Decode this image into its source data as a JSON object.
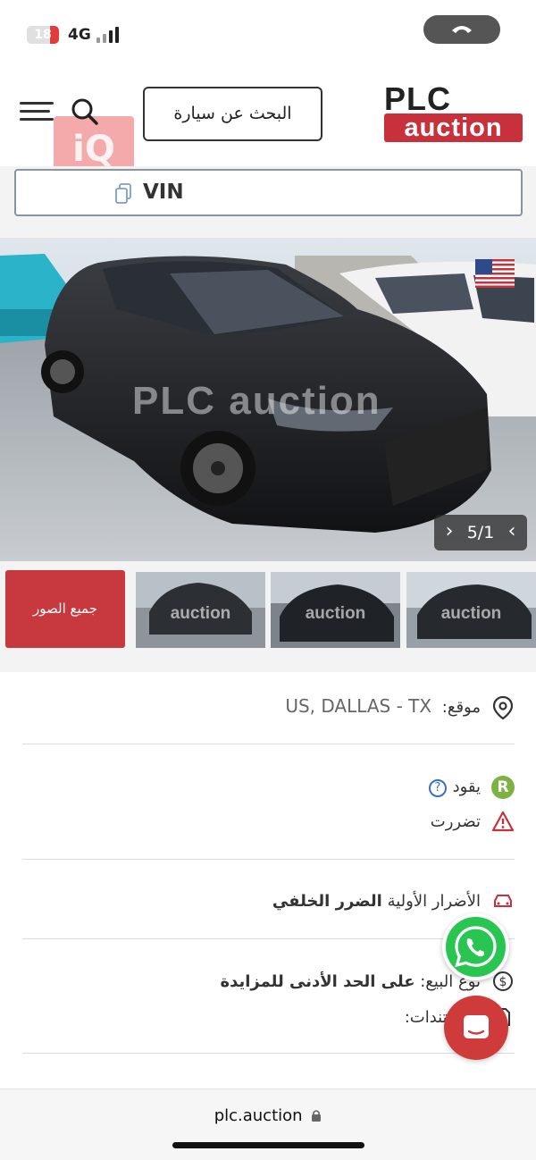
{
  "status_bar": {
    "battery": "18",
    "network": "4G"
  },
  "header": {
    "search_car_label": "البحث عن سيارة",
    "logo_top": "PLC",
    "logo_bottom": "auction",
    "overlay_badge": "iQ"
  },
  "vin": {
    "label": "VIN"
  },
  "gallery": {
    "counter": "5/1",
    "watermark": "PLC auction",
    "prev_icon": "chevron-left-icon",
    "next_icon": "chevron-right-icon",
    "flag": "us-flag-icon",
    "all_photos_label": "جميع الصور",
    "thumb_watermark": "auction"
  },
  "details": {
    "location_label": "موقع:",
    "location_value": "US, DALLAS - TX",
    "runs_label": "يقود",
    "damaged_label": "تضررت",
    "primary_damage_label": "الأضرار الأولية",
    "primary_damage_value": "الضرر الخلفي",
    "sale_type_label": "نوع البيع:",
    "sale_type_value": "على الحد الأدنى للمزايدة",
    "documents_label": "المستندات:",
    "run_badge": "R",
    "help_mark": "?"
  },
  "browser": {
    "url": "plc.auction"
  },
  "colors": {
    "brand_red": "#c8313b",
    "whatsapp_green": "#28c650",
    "run_badge_green": "#7cb342"
  }
}
